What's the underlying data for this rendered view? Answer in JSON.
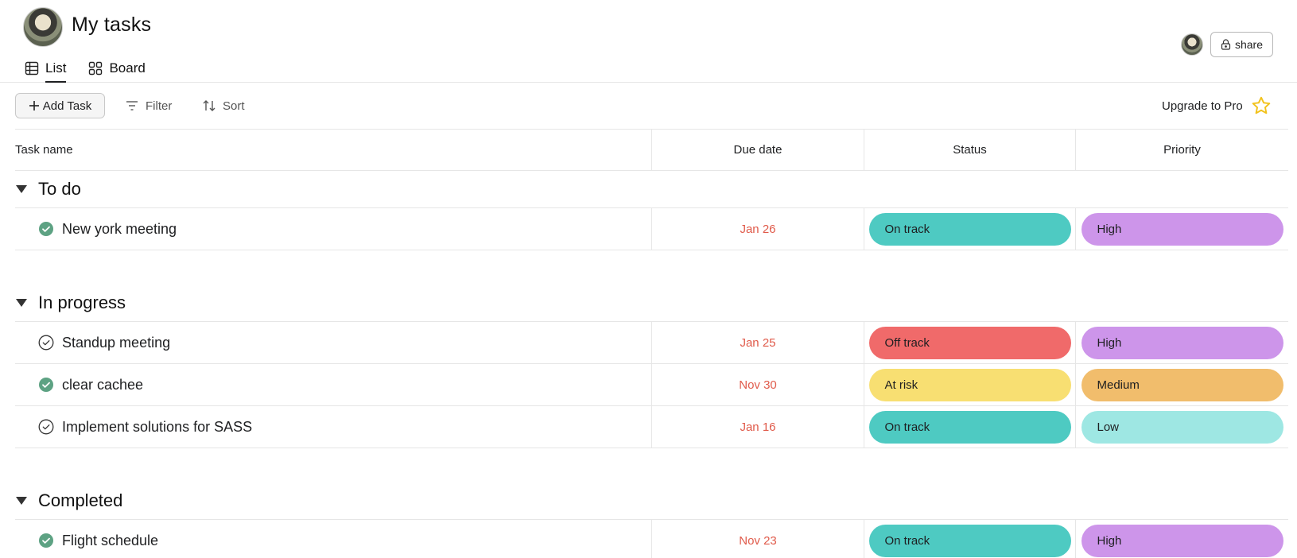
{
  "header": {
    "title": "My tasks",
    "tabs": [
      {
        "label": "List",
        "active": true,
        "icon": "table-icon"
      },
      {
        "label": "Board",
        "active": false,
        "icon": "board-icon"
      }
    ],
    "share_label": "share"
  },
  "toolbar": {
    "add_task_label": "Add Task",
    "filter_label": "Filter",
    "sort_label": "Sort",
    "upgrade_label": "Upgrade to Pro"
  },
  "columns": {
    "name": "Task name",
    "due": "Due date",
    "status": "Status",
    "priority": "Priority"
  },
  "colors": {
    "on_track": "#4ecac2",
    "off_track": "#f06a6a",
    "at_risk": "#f8df72",
    "high": "#cd95ea",
    "medium": "#f1bd6c",
    "low": "#9ee7e3",
    "due_text": "#e05a4a",
    "complete_check": "#5da283",
    "star": "#f2c21b"
  },
  "sections": [
    {
      "title": "To do",
      "tasks": [
        {
          "name": "New york meeting",
          "due": "Jan 26",
          "status": "On track",
          "priority": "High",
          "done": true
        }
      ]
    },
    {
      "title": "In progress",
      "tasks": [
        {
          "name": "Standup meeting",
          "due": "Jan 25",
          "status": "Off track",
          "priority": "High",
          "done": false
        },
        {
          "name": "clear cachee",
          "due": "Nov 30",
          "status": "At risk",
          "priority": "Medium",
          "done": true
        },
        {
          "name": "Implement solutions for SASS",
          "due": "Jan 16",
          "status": "On track",
          "priority": "Low",
          "done": false
        }
      ]
    },
    {
      "title": "Completed",
      "tasks": [
        {
          "name": "Flight schedule",
          "due": "Nov 23",
          "status": "On track",
          "priority": "High",
          "done": true
        }
      ]
    }
  ]
}
